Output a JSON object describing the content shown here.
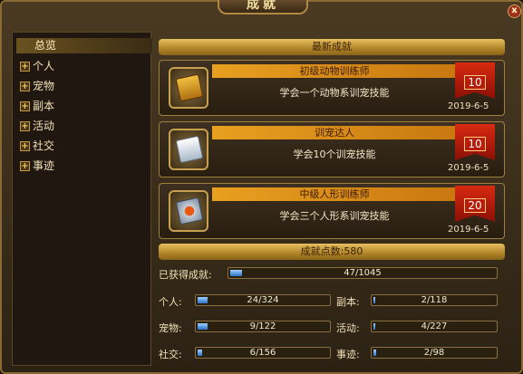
{
  "window": {
    "title": "成就",
    "close_label": "x"
  },
  "sidebar": {
    "items": [
      {
        "label": "总览",
        "selected": true
      },
      {
        "label": "个人"
      },
      {
        "label": "宠物"
      },
      {
        "label": "副本"
      },
      {
        "label": "活动"
      },
      {
        "label": "社交"
      },
      {
        "label": "事迹"
      }
    ],
    "expand_icon": "plus-icon"
  },
  "recent": {
    "header": "最新成就",
    "items": [
      {
        "name": "初级动物训练师",
        "desc": "学会一个动物系训宠技能",
        "points": "10",
        "date": "2019-6-5",
        "icon": "book-animal-icon",
        "icon_color": "#e0a020"
      },
      {
        "name": "训宠达人",
        "desc": "学会10个训宠技能",
        "points": "10",
        "date": "2019-6-5",
        "icon": "book-white-icon",
        "icon_color": "#e8eef4"
      },
      {
        "name": "中级人形训练师",
        "desc": "学会三个人形系训宠技能",
        "points": "20",
        "date": "2019-6-5",
        "icon": "book-humanoid-icon",
        "icon_color": "#d0d8e0"
      }
    ]
  },
  "points": {
    "label": "成就点数:",
    "value": "580"
  },
  "progress": {
    "total": {
      "label": "已获得成就:",
      "text": "47/1045",
      "fraction": 0.045
    },
    "cats": [
      {
        "label": "个人:",
        "text": "24/324",
        "fraction": 0.074
      },
      {
        "label": "副本:",
        "text": "2/118",
        "fraction": 0.017
      },
      {
        "label": "宠物:",
        "text": "9/122",
        "fraction": 0.074
      },
      {
        "label": "活动:",
        "text": "4/227",
        "fraction": 0.018
      },
      {
        "label": "社交:",
        "text": "6/156",
        "fraction": 0.038
      },
      {
        "label": "事迹:",
        "text": "2/98",
        "fraction": 0.02
      }
    ]
  },
  "colors": {
    "accent": "#d8a030",
    "badge": "#c81c0a",
    "bar_fill": "#2a70c8"
  }
}
